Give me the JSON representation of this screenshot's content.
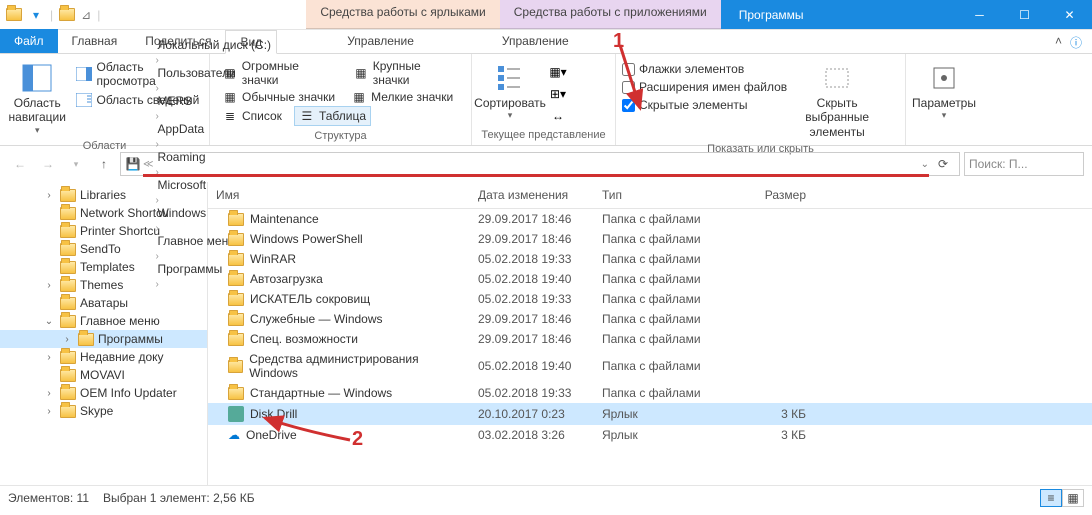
{
  "title": "Программы",
  "title_tabs": {
    "shortcut": "Средства работы с ярлыками",
    "app": "Средства работы с приложениями"
  },
  "tabs": {
    "file": "Файл",
    "home": "Главная",
    "share": "Поделиться",
    "view": "Вид",
    "manage1": "Управление",
    "manage2": "Управление"
  },
  "ribbon": {
    "nav_pane": "Область навигации",
    "preview_pane": "Область просмотра",
    "details_pane": "Область сведений",
    "areas_label": "Области",
    "layout": {
      "huge": "Огромные значки",
      "large": "Крупные значки",
      "medium": "Обычные значки",
      "small": "Мелкие значки",
      "list": "Список",
      "table": "Таблица"
    },
    "structure_label": "Структура",
    "sort": "Сортировать",
    "current_label": "Текущее представление",
    "checks": {
      "flags": "Флажки элементов",
      "ext": "Расширения имен файлов",
      "hidden": "Скрытые элементы"
    },
    "hide_btn": "Скрыть выбранные элементы",
    "show_hide_label": "Показать или скрыть",
    "options": "Параметры"
  },
  "breadcrumbs": [
    "Локальный диск (C:)",
    "Пользователи",
    "MERS",
    "AppData",
    "Roaming",
    "Microsoft",
    "Windows",
    "Главное меню",
    "Программы"
  ],
  "search_placeholder": "Поиск: П...",
  "tree": [
    {
      "label": "Libraries",
      "depth": 1,
      "exp": ">"
    },
    {
      "label": "Network Shortcu",
      "depth": 1,
      "exp": ""
    },
    {
      "label": "Printer Shortcu",
      "depth": 1,
      "exp": ""
    },
    {
      "label": "SendTo",
      "depth": 1,
      "exp": ""
    },
    {
      "label": "Templates",
      "depth": 1,
      "exp": ""
    },
    {
      "label": "Themes",
      "depth": 1,
      "exp": ">"
    },
    {
      "label": "Аватары",
      "depth": 1,
      "exp": ""
    },
    {
      "label": "Главное меню",
      "depth": 1,
      "exp": "v"
    },
    {
      "label": "Программы",
      "depth": 2,
      "exp": ">",
      "sel": true
    },
    {
      "label": "Недавние доку",
      "depth": 1,
      "exp": ">"
    },
    {
      "label": "MOVAVI",
      "depth": 1,
      "exp": ""
    },
    {
      "label": "OEM Info Updater",
      "depth": 1,
      "exp": ">"
    },
    {
      "label": "Skype",
      "depth": 1,
      "exp": ">"
    }
  ],
  "columns": {
    "name": "Имя",
    "date": "Дата изменения",
    "type": "Тип",
    "size": "Размер"
  },
  "rows": [
    {
      "name": "Maintenance",
      "date": "29.09.2017 18:46",
      "type": "Папка с файлами",
      "size": "",
      "icon": "folder"
    },
    {
      "name": "Windows PowerShell",
      "date": "29.09.2017 18:46",
      "type": "Папка с файлами",
      "size": "",
      "icon": "folder"
    },
    {
      "name": "WinRAR",
      "date": "05.02.2018 19:33",
      "type": "Папка с файлами",
      "size": "",
      "icon": "folder"
    },
    {
      "name": "Автозагрузка",
      "date": "05.02.2018 19:40",
      "type": "Папка с файлами",
      "size": "",
      "icon": "folder"
    },
    {
      "name": "ИСКАТЕЛЬ сокровищ",
      "date": "05.02.2018 19:33",
      "type": "Папка с файлами",
      "size": "",
      "icon": "folder"
    },
    {
      "name": "Служебные — Windows",
      "date": "29.09.2017 18:46",
      "type": "Папка с файлами",
      "size": "",
      "icon": "folder"
    },
    {
      "name": "Спец. возможности",
      "date": "29.09.2017 18:46",
      "type": "Папка с файлами",
      "size": "",
      "icon": "folder"
    },
    {
      "name": "Средства администрирования Windows",
      "date": "05.02.2018 19:40",
      "type": "Папка с файлами",
      "size": "",
      "icon": "folder"
    },
    {
      "name": "Стандартные — Windows",
      "date": "05.02.2018 19:33",
      "type": "Папка с файлами",
      "size": "",
      "icon": "folder"
    },
    {
      "name": "Disk Drill",
      "date": "20.10.2017 0:23",
      "type": "Ярлык",
      "size": "3 КБ",
      "icon": "shortcut",
      "sel": true
    },
    {
      "name": "OneDrive",
      "date": "03.02.2018 3:26",
      "type": "Ярлык",
      "size": "3 КБ",
      "icon": "cloud"
    }
  ],
  "status": {
    "count": "Элементов: 11",
    "selected": "Выбран 1 элемент: 2,56 КБ"
  },
  "anno": {
    "one": "1",
    "two": "2"
  }
}
